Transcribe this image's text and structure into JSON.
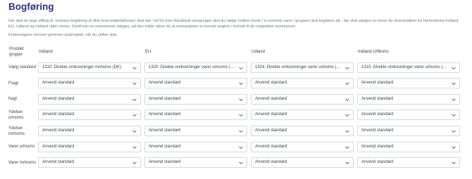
{
  "title": "Bogføring",
  "description": [
    "Her skal du tage stilling til, hvordan bogføring af dine leverandørfakturaer skal ske. Ud for hver Rackbeat varegruppe skal du vælge hvilken konto i e-conomic varer i gruppen skal bogføres på - der skal vælges en konto for leverandører fra henholdsvis Indland, EU, Udland og Indland uden moms. Dertil kan en momskonto vælges, på den måde sikrer du at momssatsen er korrekt angivet i forhold til de respektive momszoner.",
    "Kontovalgene herover gemmes automatisk, når du skifter side."
  ],
  "table": {
    "columns": [
      "Produkt gruppe",
      "Indland",
      "EU",
      "Udland",
      "Indland U/Moms"
    ],
    "rows": [
      {
        "label": "Vælg standard",
        "values": [
          "1310: Direkte omkostninger m/moms (DK)",
          "1320: Direkte omkostninger varer u/moms (EU)",
          "1324: Direkte omkostninger varer u/moms (Udland)",
          "1315: Direkte omkostninger varer u/moms (DK)"
        ]
      },
      {
        "label": "Fragt",
        "values": [
          "Anvend standard",
          "Anvend standard",
          "Anvend standard",
          "Anvend standard"
        ]
      },
      {
        "label": "fragt",
        "values": [
          "Anvend standard",
          "Anvend standard",
          "Anvend standard",
          "Anvend standard"
        ]
      },
      {
        "label": "Ydelser u/moms",
        "values": [
          "Anvend standard",
          "Anvend standard",
          "Anvend standard",
          "Anvend standard"
        ]
      },
      {
        "label": "Ydelser m/moms",
        "values": [
          "Anvend standard",
          "Anvend standard",
          "Anvend standard",
          "Anvend standard"
        ]
      },
      {
        "label": "Varer u/moms",
        "values": [
          "Anvend standard",
          "Anvend standard",
          "Anvend standard",
          "Anvend standard"
        ]
      },
      {
        "label": "Varer m/moms",
        "values": [
          "Anvend standard",
          "Anvend standard",
          "Anvend standard",
          "Anvend standard"
        ]
      }
    ]
  },
  "icons": {
    "select_arrow": "chevron-down-icon"
  },
  "colors": {
    "title": "#2a3480",
    "border": "#d3d7dd",
    "muted_text": "#6e7681"
  }
}
